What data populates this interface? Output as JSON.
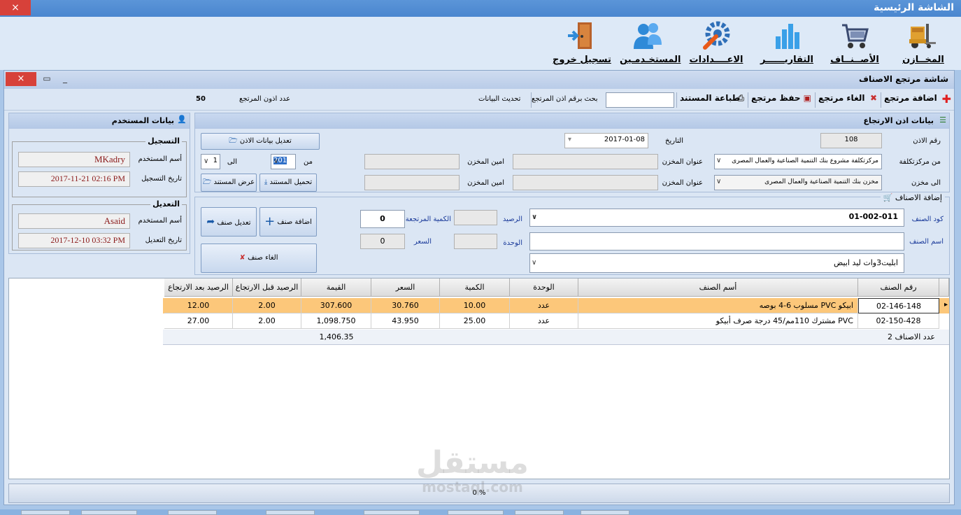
{
  "app": {
    "title": "الشاشة الرئيسية",
    "close": "×"
  },
  "menu": [
    {
      "id": "stores",
      "label": "المخــازن",
      "icon": "forklift-icon"
    },
    {
      "id": "items",
      "label": "الأصــنــاف",
      "icon": "shopping-cart-icon"
    },
    {
      "id": "reports",
      "label": "التقاريــــــر",
      "icon": "bar-chart-icon"
    },
    {
      "id": "settings",
      "label": "الاعــــدادات",
      "icon": "gear-wrench-icon"
    },
    {
      "id": "users",
      "label": "المستخـدمـين",
      "icon": "users-icon"
    },
    {
      "id": "logout",
      "label": "تسجيل خروج",
      "icon": "exit-door-icon"
    }
  ],
  "child": {
    "title": "شاشة مرتجع الاصناف",
    "close": "×"
  },
  "toolbar": {
    "add": "اضافة مرتجع",
    "cancel": "الغاء مرتجع",
    "save": "حفظ مرتجع",
    "print": "طباعة المستند",
    "search_label": "بحث برقم اذن المرتجع",
    "search_value": "",
    "refresh": "تحديث البيانات",
    "count_label": "عدد اذون المرتجع",
    "count_value": "50"
  },
  "permit": {
    "header": "بيانات اذن الارتجاع",
    "permit_no_label": "رقم الاذن",
    "permit_no": "108",
    "date_label": "التاريخ",
    "date": "2017-01-08",
    "from_cost_label": "من مركزتكلفة",
    "from_cost": "مركزتكلفة مشروع بنك التنمية الصناعية والعمال المصرى",
    "to_store_label": "الى مخزن",
    "to_store": "مخزن بنك التنمية الصناعية والعمال المصرى",
    "store_addr_label": "عنوان المخزن",
    "store_addr_label2": "عنوان المخزن",
    "keeper_label": "امين المخزن",
    "keeper_label2": "امين المخزن",
    "from_label": "من",
    "from_value": "201",
    "to_label": "الى",
    "to_value": "1",
    "edit_btn": "تعديل بيانات الاذن",
    "upload_btn": "تحميل المستند",
    "view_btn": "عرض المستند"
  },
  "user": {
    "header": "بيانات المستخدم",
    "reg_title": "التسجيل",
    "reg_user_label": "أسم المستخدم",
    "reg_user": "MKadry",
    "reg_date_label": "تاريخ التسجيل",
    "reg_date": "2017-11-21 02:16 PM",
    "edit_title": "التعديل",
    "edit_user_label": "أسم المستخدم",
    "edit_user": "Asaid",
    "edit_date_label": "تاريخ التعديل",
    "edit_date": "2017-12-10 03:32 PM"
  },
  "additem": {
    "header": "إضافة الاصناف",
    "code_label": "كود الصنف",
    "code": "01-002-011",
    "name_label": "اسم الصنف",
    "name": "",
    "desc": "ابليت3وات ليد ابيض",
    "balance_label": "الرصيد",
    "unit_label": "الوحدة",
    "qty_label": "الكمية المرتجعة",
    "qty": "0",
    "price_label": "السعر",
    "price": "0",
    "add_btn": "اضافة صنف",
    "edit_btn": "تعديل صنف",
    "cancel_btn": "الغاء صنف"
  },
  "grid": {
    "columns": [
      "رقم الصنف",
      "أسم الصنف",
      "الوحدة",
      "الكمية",
      "السعر",
      "القيمة",
      "الرصيد قبل الارتجاع",
      "الرصيد بعد الارتجاع"
    ],
    "rows": [
      [
        "02-146-148",
        "مسلوب 6-4 بوصه PVC ابيكو",
        "عدد",
        "10.00",
        "30.760",
        "307.600",
        "2.00",
        "12.00"
      ],
      [
        "02-150-428",
        "مشترك 110مم/45 درجة  صرف أبيكو PVC",
        "عدد",
        "25.00",
        "43.950",
        "1,098.750",
        "2.00",
        "27.00"
      ]
    ],
    "footer_count": "عدد الاصناف 2",
    "footer_total": "1,406.35"
  },
  "status": {
    "progress": "0 %"
  },
  "watermark": {
    "line1": "مستقل",
    "line2": "mostaql.com"
  }
}
